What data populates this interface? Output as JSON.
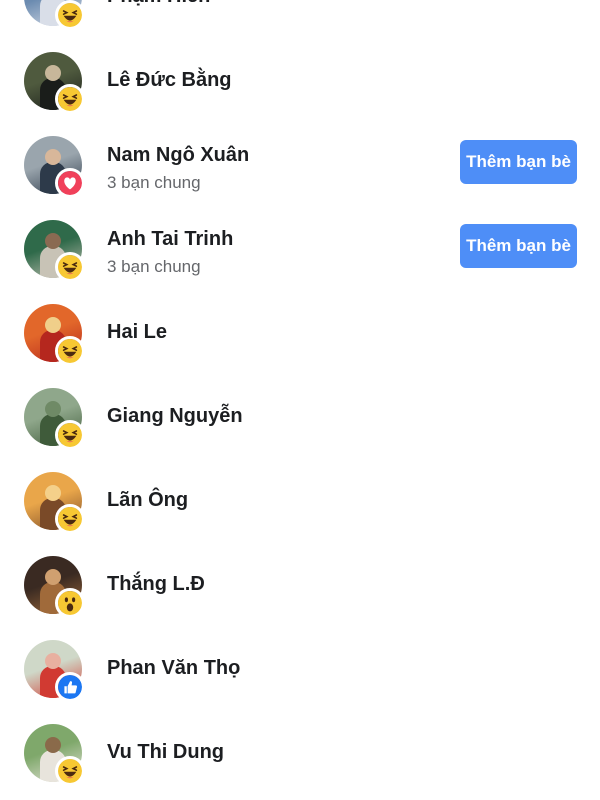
{
  "people": [
    {
      "name": "Phạm Hiền",
      "mutual": "",
      "reaction": "haha-icon",
      "button": "",
      "colors": [
        "#6b8bb0",
        "#d9dee8",
        "#334"
      ]
    },
    {
      "name": "Lê Đức Bằng",
      "mutual": "",
      "reaction": "haha-icon",
      "button": "",
      "colors": [
        "#4f5a3e",
        "#1a1d1a",
        "#c7b79a"
      ]
    },
    {
      "name": "Nam Ngô Xuân",
      "mutual": "3 bạn chung",
      "reaction": "love-icon",
      "button": "Thêm bạn bè",
      "colors": [
        "#9aa5ad",
        "#2d3a4a",
        "#d8b79a"
      ]
    },
    {
      "name": "Anh Tai Trinh",
      "mutual": "3 bạn chung",
      "reaction": "haha-icon",
      "button": "Thêm bạn bè",
      "colors": [
        "#2f6a4a",
        "#c8c3b6",
        "#8a6a52"
      ]
    },
    {
      "name": "Hai Le",
      "mutual": "",
      "reaction": "haha-icon",
      "button": "",
      "colors": [
        "#e2672a",
        "#b5271e",
        "#f0cf8a"
      ]
    },
    {
      "name": "Giang Nguyễn",
      "mutual": "",
      "reaction": "haha-icon",
      "button": "",
      "colors": [
        "#8fa78b",
        "#3f5b3a",
        "#6f8a66"
      ]
    },
    {
      "name": "Lãn Ông",
      "mutual": "",
      "reaction": "haha-icon",
      "button": "",
      "colors": [
        "#e9a64a",
        "#7a4a28",
        "#f4d08a"
      ]
    },
    {
      "name": "Thắng L.Đ",
      "mutual": "",
      "reaction": "wow-icon",
      "button": "",
      "colors": [
        "#3a2a22",
        "#a06a3a",
        "#d0a070"
      ]
    },
    {
      "name": "Phan Văn Thọ",
      "mutual": "",
      "reaction": "like-icon",
      "button": "",
      "colors": [
        "#cfd8c8",
        "#d13a32",
        "#e8b0a0"
      ]
    },
    {
      "name": "Vu Thi Dung",
      "mutual": "",
      "reaction": "haha-icon",
      "button": "",
      "colors": [
        "#7fa86b",
        "#e8e4dc",
        "#8a6a4a"
      ]
    }
  ],
  "colors": {
    "button_bg": "#4e8ef7",
    "name_text": "#1c1e21",
    "sub_text": "#65676b"
  }
}
